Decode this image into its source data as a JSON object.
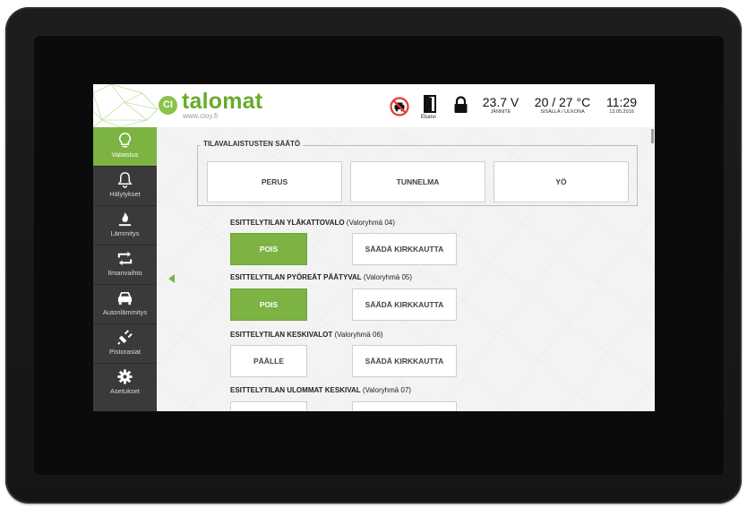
{
  "header": {
    "brand_badge": "CI",
    "brand_name": "talomat",
    "brand_url": "www.cioy.fi",
    "door_label": "Etuovi",
    "voltage_value": "23.7 V",
    "voltage_label": "JÄNNITE",
    "temp_value": "20 / 27 °C",
    "temp_label": "SISÄLLÄ / ULKONA",
    "time_value": "11:29",
    "date_value": "13.05.2016",
    "icons": [
      "no-car-icon",
      "door-icon",
      "lock-icon"
    ]
  },
  "sidebar": {
    "items": [
      {
        "label": "Valaistus",
        "icon": "lightbulb-icon",
        "active": true
      },
      {
        "label": "Hälytykset",
        "icon": "bell-icon",
        "active": false
      },
      {
        "label": "Lämmitys",
        "icon": "flame-icon",
        "active": false
      },
      {
        "label": "Ilmanvaihto",
        "icon": "ventilation-icon",
        "active": false
      },
      {
        "label": "Autonlämmitys",
        "icon": "car-icon",
        "active": false
      },
      {
        "label": "Pistorasiat",
        "icon": "plug-icon",
        "active": false
      },
      {
        "label": "Asetukset",
        "icon": "gear-icon",
        "active": false
      }
    ]
  },
  "scenes": {
    "legend": "TILAVALAISTUSTEN SÄÄTÖ",
    "buttons": [
      "PERUS",
      "TUNNELMA",
      "YÖ"
    ]
  },
  "groups": [
    {
      "name": "ESITTELYTILAN YLÄKATTOVALO",
      "group": "(Valoryhmä 04)",
      "toggle": "POIS",
      "toggle_on": true,
      "dim": "SÄÄDÄ KIRKKAUTTA"
    },
    {
      "name": "ESITTELYTILAN PYÖREÄT PÄÄTYVAL",
      "group": "(Valoryhmä 05)",
      "toggle": "POIS",
      "toggle_on": true,
      "dim": "SÄÄDÄ KIRKKAUTTA"
    },
    {
      "name": "ESITTELYTILAN KESKIVALOT",
      "group": "(Valoryhmä 06)",
      "toggle": "PÄÄLLE",
      "toggle_on": false,
      "dim": "SÄÄDÄ KIRKKAUTTA"
    },
    {
      "name": "ESITTELYTILAN ULOMMAT KESKIVAL",
      "group": "(Valoryhmä 07)",
      "toggle": "",
      "toggle_on": false,
      "dim": ""
    }
  ],
  "colors": {
    "accent": "#7cb342",
    "sidebar_dark": "#3a3a3a",
    "frame": "#1a1a1a"
  }
}
